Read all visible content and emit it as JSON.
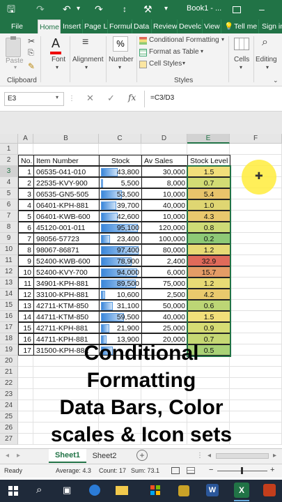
{
  "app": {
    "title": "Book1 - ...",
    "brand_color": "#217346"
  },
  "quick_access": {
    "save_icon": "save-icon",
    "undo_icon": "undo-icon",
    "redo_icon": "redo-icon"
  },
  "tabs": [
    "File",
    "Home",
    "Insert",
    "Page L",
    "Formul",
    "Data",
    "Review",
    "Develc",
    "View",
    "Tell me",
    "Sign in"
  ],
  "ribbon": {
    "paste": "Paste",
    "clipboard": "Clipboard",
    "font": "Font",
    "alignment": "Alignment",
    "number": "Number",
    "conditional_formatting": "Conditional Formatting",
    "format_as_table": "Format as Table",
    "cell_styles": "Cell Styles",
    "styles": "Styles",
    "cells": "Cells",
    "editing": "Editing"
  },
  "formula_bar": {
    "name_box": "E3",
    "fx": "fx",
    "formula": "=C3/D3"
  },
  "grid": {
    "columns": [
      "A",
      "B",
      "C",
      "D",
      "E",
      "F"
    ],
    "header_row": [
      "No.",
      "Item Number",
      "Stock",
      "Av Sales",
      "Stock Level"
    ],
    "rows": [
      {
        "no": "1",
        "item": "06535-041-010",
        "stock": "43,800",
        "sales": "30,000",
        "level": "1.5",
        "level_color": "#f2df7a",
        "bar": 0.44
      },
      {
        "no": "2",
        "item": "22535-KVY-900",
        "stock": "5,500",
        "sales": "8,000",
        "level": "0.7",
        "level_color": "#d2dc74",
        "bar": 0.06
      },
      {
        "no": "3",
        "item": "06535-GN5-505",
        "stock": "53,500",
        "sales": "10,000",
        "level": "5.4",
        "level_color": "#e8c46b",
        "bar": 0.54
      },
      {
        "no": "4",
        "item": "06401-KPH-881",
        "stock": "39,700",
        "sales": "40,000",
        "level": "1.0",
        "level_color": "#dfd672",
        "bar": 0.4
      },
      {
        "no": "5",
        "item": "06401-KWB-600",
        "stock": "42,600",
        "sales": "10,000",
        "level": "4.3",
        "level_color": "#e9c86d",
        "bar": 0.43
      },
      {
        "no": "6",
        "item": "45120-001-011",
        "stock": "95,100",
        "sales": "120,000",
        "level": "0.8",
        "level_color": "#cddb76",
        "bar": 0.96
      },
      {
        "no": "7",
        "item": "98056-57723",
        "stock": "23,400",
        "sales": "100,000",
        "level": "0.2",
        "level_color": "#8ec976",
        "bar": 0.24
      },
      {
        "no": "8",
        "item": "98067-86871",
        "stock": "97,400",
        "sales": "80,000",
        "level": "1.2",
        "level_color": "#e7da75",
        "bar": 0.99
      },
      {
        "no": "9",
        "item": "52400-KWB-600",
        "stock": "78,900",
        "sales": "2,400",
        "level": "32.9",
        "level_color": "#e06a5a",
        "bar": 0.8
      },
      {
        "no": "10",
        "item": "52400-KVY-700",
        "stock": "94,000",
        "sales": "6,000",
        "level": "15.7",
        "level_color": "#e49c66",
        "bar": 0.95
      },
      {
        "no": "11",
        "item": "34901-KPH-881",
        "stock": "89,500",
        "sales": "75,000",
        "level": "1.2",
        "level_color": "#e7da75",
        "bar": 0.9
      },
      {
        "no": "12",
        "item": "33100-KPH-881",
        "stock": "10,600",
        "sales": "2,500",
        "level": "4.2",
        "level_color": "#e9c96d",
        "bar": 0.11
      },
      {
        "no": "13",
        "item": "42711-KTM-850",
        "stock": "31,100",
        "sales": "50,000",
        "level": "0.6",
        "level_color": "#bcd675",
        "bar": 0.31
      },
      {
        "no": "14",
        "item": "44711-KTM-850",
        "stock": "59,500",
        "sales": "40,000",
        "level": "1.5",
        "level_color": "#f2df7a",
        "bar": 0.6
      },
      {
        "no": "15",
        "item": "42711-KPH-881",
        "stock": "21,900",
        "sales": "25,000",
        "level": "0.9",
        "level_color": "#d6dc74",
        "bar": 0.22
      },
      {
        "no": "16",
        "item": "44711-KPH-881",
        "stock": "13,900",
        "sales": "20,000",
        "level": "0.7",
        "level_color": "#c6d874",
        "bar": 0.14
      },
      {
        "no": "17",
        "item": "31500-KPH-881",
        "stock": "",
        "sales": "",
        "level": "0.5",
        "level_color": "#a9d176",
        "bar": 0.3
      }
    ]
  },
  "overlay_lines": [
    "Conditional",
    "Formatting",
    "Data Bars, Color",
    "scales & Icon sets"
  ],
  "sheets": [
    "Sheet1",
    "Sheet2"
  ],
  "status": {
    "ready": "Ready",
    "average": "Average: 4.3",
    "count": "Count: 17",
    "sum": "Sum: 73.1"
  }
}
